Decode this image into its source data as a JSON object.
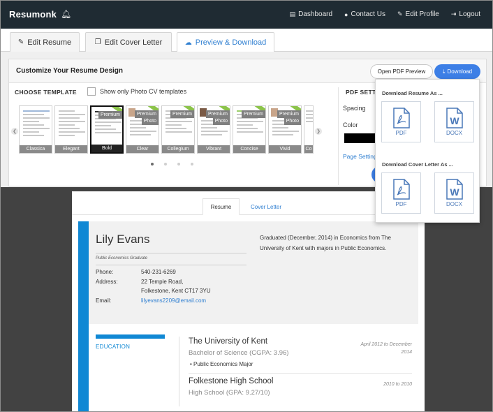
{
  "topbar": {
    "brand": "Resumonk",
    "nav": [
      {
        "label": "Dashboard",
        "icon": "dashboard-icon"
      },
      {
        "label": "Contact Us",
        "icon": "chat-icon"
      },
      {
        "label": "Edit Profile",
        "icon": "pencil-icon"
      },
      {
        "label": "Logout",
        "icon": "logout-icon"
      }
    ]
  },
  "tabs": [
    {
      "label": "Edit Resume",
      "icon": "edit-icon"
    },
    {
      "label": "Edit Cover Letter",
      "icon": "copy-icon"
    },
    {
      "label": "Preview & Download",
      "icon": "cloud-download-icon",
      "active": true
    }
  ],
  "customize": {
    "title": "Customize Your Resume Design",
    "open_pdf_label": "Open PDF Preview",
    "download_label": "Download",
    "choose_template": "CHOOSE TEMPLATE",
    "photo_only_label": "Show only Photo CV templates",
    "templates": [
      {
        "name": "Classica",
        "premium": false,
        "photo": false
      },
      {
        "name": "Elegant",
        "premium": false,
        "photo": false
      },
      {
        "name": "Bold",
        "premium": true,
        "photo": false,
        "selected": true
      },
      {
        "name": "Clear",
        "premium": true,
        "photo": true
      },
      {
        "name": "Collegium",
        "premium": true,
        "photo": false
      },
      {
        "name": "Vibrant",
        "premium": true,
        "photo": true
      },
      {
        "name": "Concise",
        "premium": true,
        "photo": false
      },
      {
        "name": "Vivid",
        "premium": true,
        "photo": true
      },
      {
        "name": "Co",
        "premium": false,
        "photo": false
      }
    ],
    "premium_badge": "Premium",
    "photo_badge": "Photo",
    "pdf_settings_title": "PDF SETTINGS",
    "spacing_label": "Spacing",
    "color_label": "Color",
    "color_value": "#000000",
    "page_settings_label": "Page Settings"
  },
  "download_menu": {
    "resume_title": "Download Resume As ...",
    "cover_title": "Download Cover Letter As ...",
    "pdf_label": "PDF",
    "docx_label": "DOCX"
  },
  "preview": {
    "tabs": [
      "Resume",
      "Cover Letter"
    ],
    "name": "Lily Evans",
    "subtitle": "Public Economics Graduate",
    "phone_label": "Phone:",
    "phone": "540-231-6269",
    "address_label": "Address:",
    "address_line1": "22 Temple Road,",
    "address_line2": "Folkestone, Kent CT17 3YU",
    "email_label": "Email:",
    "email": "lilyevans2209@email.com",
    "summary": "Graduated (December, 2014) in Economics from The University of Kent with majors in Public Economics.",
    "education_label": "EDUCATION",
    "education": [
      {
        "school": "The University of Kent",
        "degree": "Bachelor of Science (CGPA: 3.96)",
        "bullet": "Public Economics Major",
        "date_line1": "April 2012 to December",
        "date_line2": "2014"
      },
      {
        "school": "Folkestone High School",
        "degree": "High School (GPA: 9.27/10)",
        "date_line1": "2010 to 2010"
      }
    ]
  },
  "colors": {
    "nav_bg": "#1f2b33",
    "accent": "#3d7fe6",
    "resume_accent": "#1088d4",
    "preview_bg": "#424242"
  }
}
